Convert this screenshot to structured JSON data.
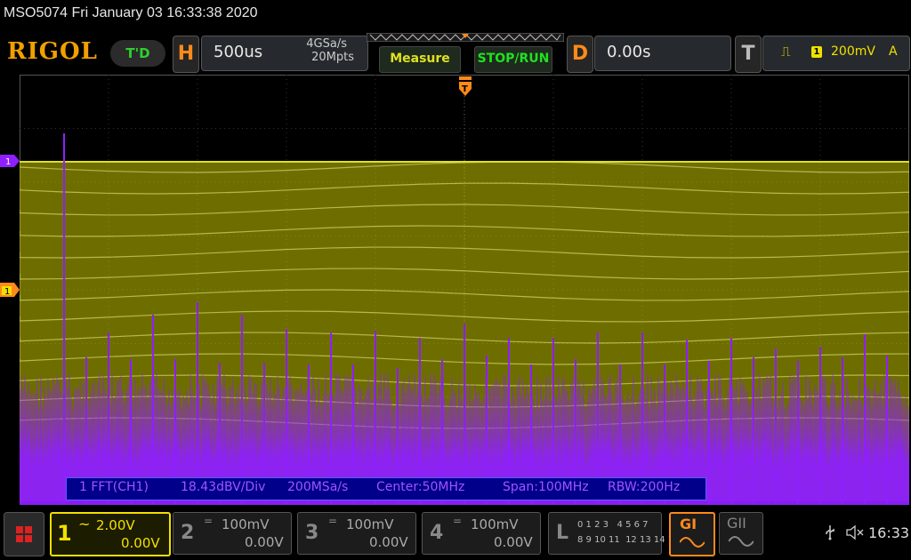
{
  "title": "MSO5074  Fri January 03 16:33:38 2020",
  "logo": "RIGOL",
  "run_state": "T'D",
  "horizontal": {
    "letter": "H",
    "timebase": "500us",
    "sample_rate": "4GSa/s",
    "memory_depth": "20Mpts"
  },
  "buttons": {
    "measure": "Measure",
    "stop_run": "STOP/RUN"
  },
  "delay": {
    "letter": "D",
    "value": "0.00s"
  },
  "trigger": {
    "letter": "T",
    "source": "1",
    "level": "200mV",
    "mode": "A"
  },
  "fft_info": {
    "channel": "1 FFT(CH1)",
    "scale": "18.43dBV/Div",
    "sample_rate": "200MSa/s",
    "center": "Center:50MHz",
    "span": "Span:100MHz",
    "rbw": "RBW:200Hz"
  },
  "markers": {
    "ch1": "1",
    "trigger": "1"
  },
  "channels": [
    {
      "num": "1",
      "scale": "2.00V",
      "offset": "0.00V",
      "coupling": "~"
    },
    {
      "num": "2",
      "scale": "100mV",
      "offset": "0.00V",
      "coupling": "="
    },
    {
      "num": "3",
      "scale": "100mV",
      "offset": "0.00V",
      "coupling": "="
    },
    {
      "num": "4",
      "scale": "100mV",
      "offset": "0.00V",
      "coupling": "="
    }
  ],
  "logic": {
    "letter": "L",
    "row1": "0 1 2 3   4 5 6 7",
    "row2": "8 9 10 11  12 13 14 15"
  },
  "generators": {
    "g1": "GI",
    "g2": "GII"
  },
  "status": {
    "time": "16:33"
  },
  "colors": {
    "ch1": "#c8c800",
    "fft": "#8f1fff",
    "accent": "#ff8a1a",
    "trigger": "#f0e000"
  }
}
